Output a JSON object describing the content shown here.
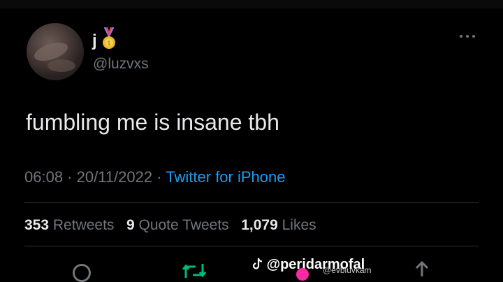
{
  "tweet": {
    "display_name": "j",
    "display_name_emoji": "medal-icon",
    "handle": "@luzvxs",
    "text": "fumbling me is insane tbh",
    "time": "06:08",
    "date": "20/11/2022",
    "separator": "·",
    "source": "Twitter for iPhone"
  },
  "stats": {
    "retweets_count": "353",
    "retweets_label": "Retweets",
    "quotes_count": "9",
    "quotes_label": "Quote Tweets",
    "likes_count": "1,079",
    "likes_label": "Likes"
  },
  "overlay": {
    "tiktok_watermark": "@peridarmofal",
    "secondary_watermark": "@evbluvkam"
  },
  "colors": {
    "background": "#000000",
    "text": "#e7e9ea",
    "muted": "#71767b",
    "link": "#1d9bf0",
    "retweet_green": "#00ba7c"
  }
}
